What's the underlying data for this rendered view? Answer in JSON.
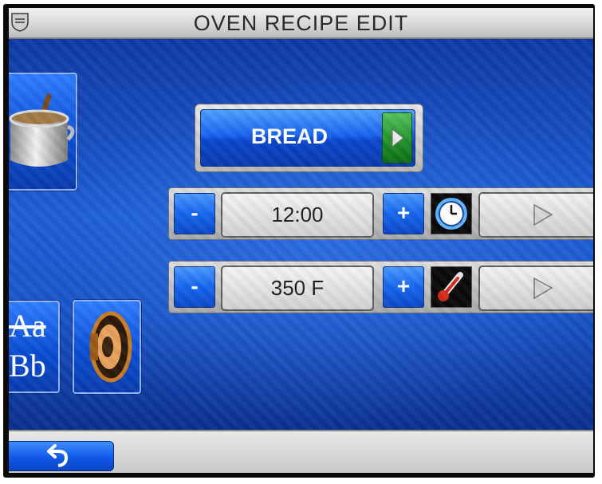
{
  "header": {
    "title": "OVEN RECIPE EDIT",
    "logo_icon": "shield-logo-icon"
  },
  "side": {
    "recipe_icon": "cooking-pot-icon",
    "font_icon_top": "Aa",
    "font_icon_bottom": "Bb",
    "sound_icon": "speaker-icon"
  },
  "recipe": {
    "name": "BREAD",
    "arrow_icon": "play-right-icon"
  },
  "time": {
    "minus_label": "-",
    "value": "12:00",
    "plus_label": "+",
    "icon": "clock-icon",
    "arrow_icon": "play-right-icon"
  },
  "temperature": {
    "minus_label": "-",
    "value": "350 F",
    "plus_label": "+",
    "icon": "thermometer-icon",
    "arrow_icon": "play-right-icon"
  },
  "footer": {
    "back_icon": "back-arrow-icon"
  },
  "colors": {
    "accent_blue": "#1a63f0",
    "go_green": "#1f8e27",
    "panel_gray": "#d2d2d2"
  }
}
